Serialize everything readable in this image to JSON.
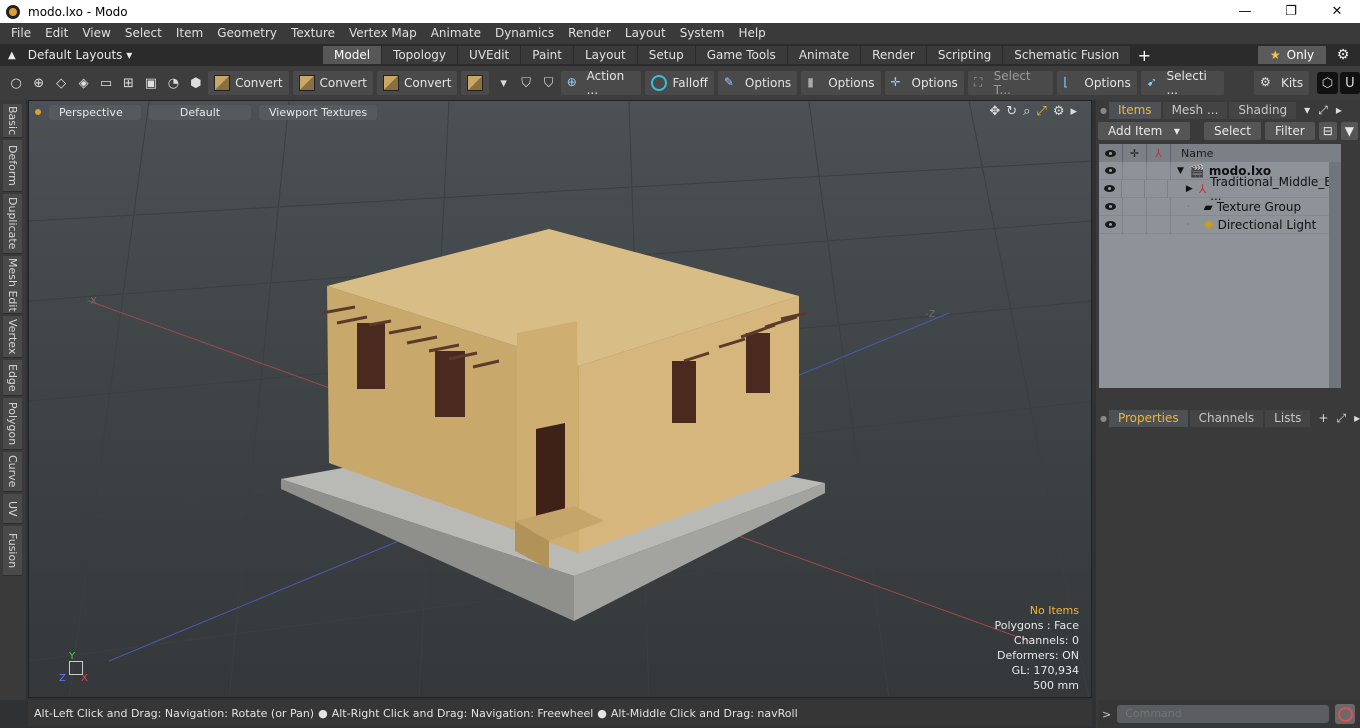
{
  "window": {
    "title": "modo.lxo - Modo",
    "buttons": [
      "—",
      "❐",
      "✕"
    ]
  },
  "menu": [
    "File",
    "Edit",
    "View",
    "Select",
    "Item",
    "Geometry",
    "Texture",
    "Vertex Map",
    "Animate",
    "Dynamics",
    "Render",
    "Layout",
    "System",
    "Help"
  ],
  "layouts": {
    "label": "Default Layouts ▾",
    "tabs": [
      "Model",
      "Topology",
      "UVEdit",
      "Paint",
      "Layout",
      "Setup",
      "Game Tools",
      "Animate",
      "Render",
      "Scripting",
      "Schematic Fusion"
    ],
    "active": "Model",
    "only_label": "Only"
  },
  "toolbar": {
    "convert1": "Convert",
    "convert2": "Convert",
    "convert3": "Convert",
    "action": "Action ...",
    "falloff": "Falloff",
    "options1": "Options",
    "options2": "Options",
    "options3": "Options",
    "select_t": "Select T...",
    "options4": "Options",
    "selecti": "Selecti ...",
    "kits": "Kits"
  },
  "left_tabs": [
    "Basic",
    "Deform",
    "Duplicate",
    "Mesh Edit",
    "Vertex",
    "Edge",
    "Polygon",
    "Curve",
    "UV",
    "Fusion"
  ],
  "viewport": {
    "view": "Perspective",
    "style": "Default",
    "shading": "Viewport Textures",
    "info": {
      "items": "No Items",
      "polygons": "Polygons : Face",
      "channels": "Channels: 0",
      "deformers": "Deformers: ON",
      "gl": "GL: 170,934",
      "scale": "500 mm"
    },
    "axis_x_neg": "-X",
    "axis_z_neg": "-Z"
  },
  "status": {
    "hint1": "Alt-Left Click and Drag: Navigation: Rotate (or Pan)",
    "hint2": "Alt-Right Click and Drag: Navigation: Freewheel",
    "hint3": "Alt-Middle Click and Drag: navRoll"
  },
  "items_panel": {
    "tabs": [
      "Items",
      "Mesh ...",
      "Shading"
    ],
    "add_item": "Add Item",
    "select": "Select",
    "filter": "Filter",
    "col_name": "Name",
    "rows": [
      {
        "name": "modo.lxo",
        "bold": true
      },
      {
        "name": "Traditional_Middle_E ..."
      },
      {
        "name": "Texture Group"
      },
      {
        "name": "Directional Light"
      }
    ]
  },
  "props_panel": {
    "tabs": [
      "Properties",
      "Channels",
      "Lists"
    ]
  },
  "command": {
    "placeholder": "Command"
  },
  "colors": {
    "accent": "#f0b43c",
    "panel": "#3a3a3a",
    "viewport": "#43484b"
  }
}
